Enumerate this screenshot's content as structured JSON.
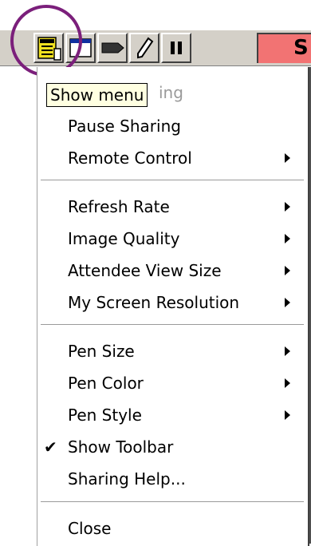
{
  "toolbar": {
    "buttons": [
      {
        "icon": "menu-icon"
      },
      {
        "icon": "window-icon"
      },
      {
        "icon": "pointer-icon"
      },
      {
        "icon": "pen-icon"
      },
      {
        "icon": "pause-icon"
      }
    ],
    "status_text": "S",
    "status_color": "#f27373"
  },
  "tooltip": {
    "text": "Show menu"
  },
  "menu": {
    "items": [
      {
        "label": "Stop Sharing",
        "visible_label": "ing",
        "disabled": true,
        "submenu": false
      },
      {
        "label": "Pause Sharing",
        "submenu": false
      },
      {
        "label": "Remote Control",
        "submenu": true
      },
      {
        "label": "Refresh Rate",
        "submenu": true
      },
      {
        "label": "Image Quality",
        "submenu": true
      },
      {
        "label": "Attendee View Size",
        "submenu": true
      },
      {
        "label": "My Screen Resolution",
        "submenu": true
      },
      {
        "label": "Pen Size",
        "submenu": true
      },
      {
        "label": "Pen Color",
        "submenu": true
      },
      {
        "label": "Pen Style",
        "submenu": true
      },
      {
        "label": "Show Toolbar",
        "checked": true,
        "submenu": false
      },
      {
        "label": "Sharing Help...",
        "submenu": false
      },
      {
        "label": "Close",
        "submenu": false
      }
    ]
  },
  "colors": {
    "highlight_ring": "#7b1f7b",
    "toolbar_bg": "#d4d0c8",
    "tooltip_bg": "#ffffe1"
  }
}
